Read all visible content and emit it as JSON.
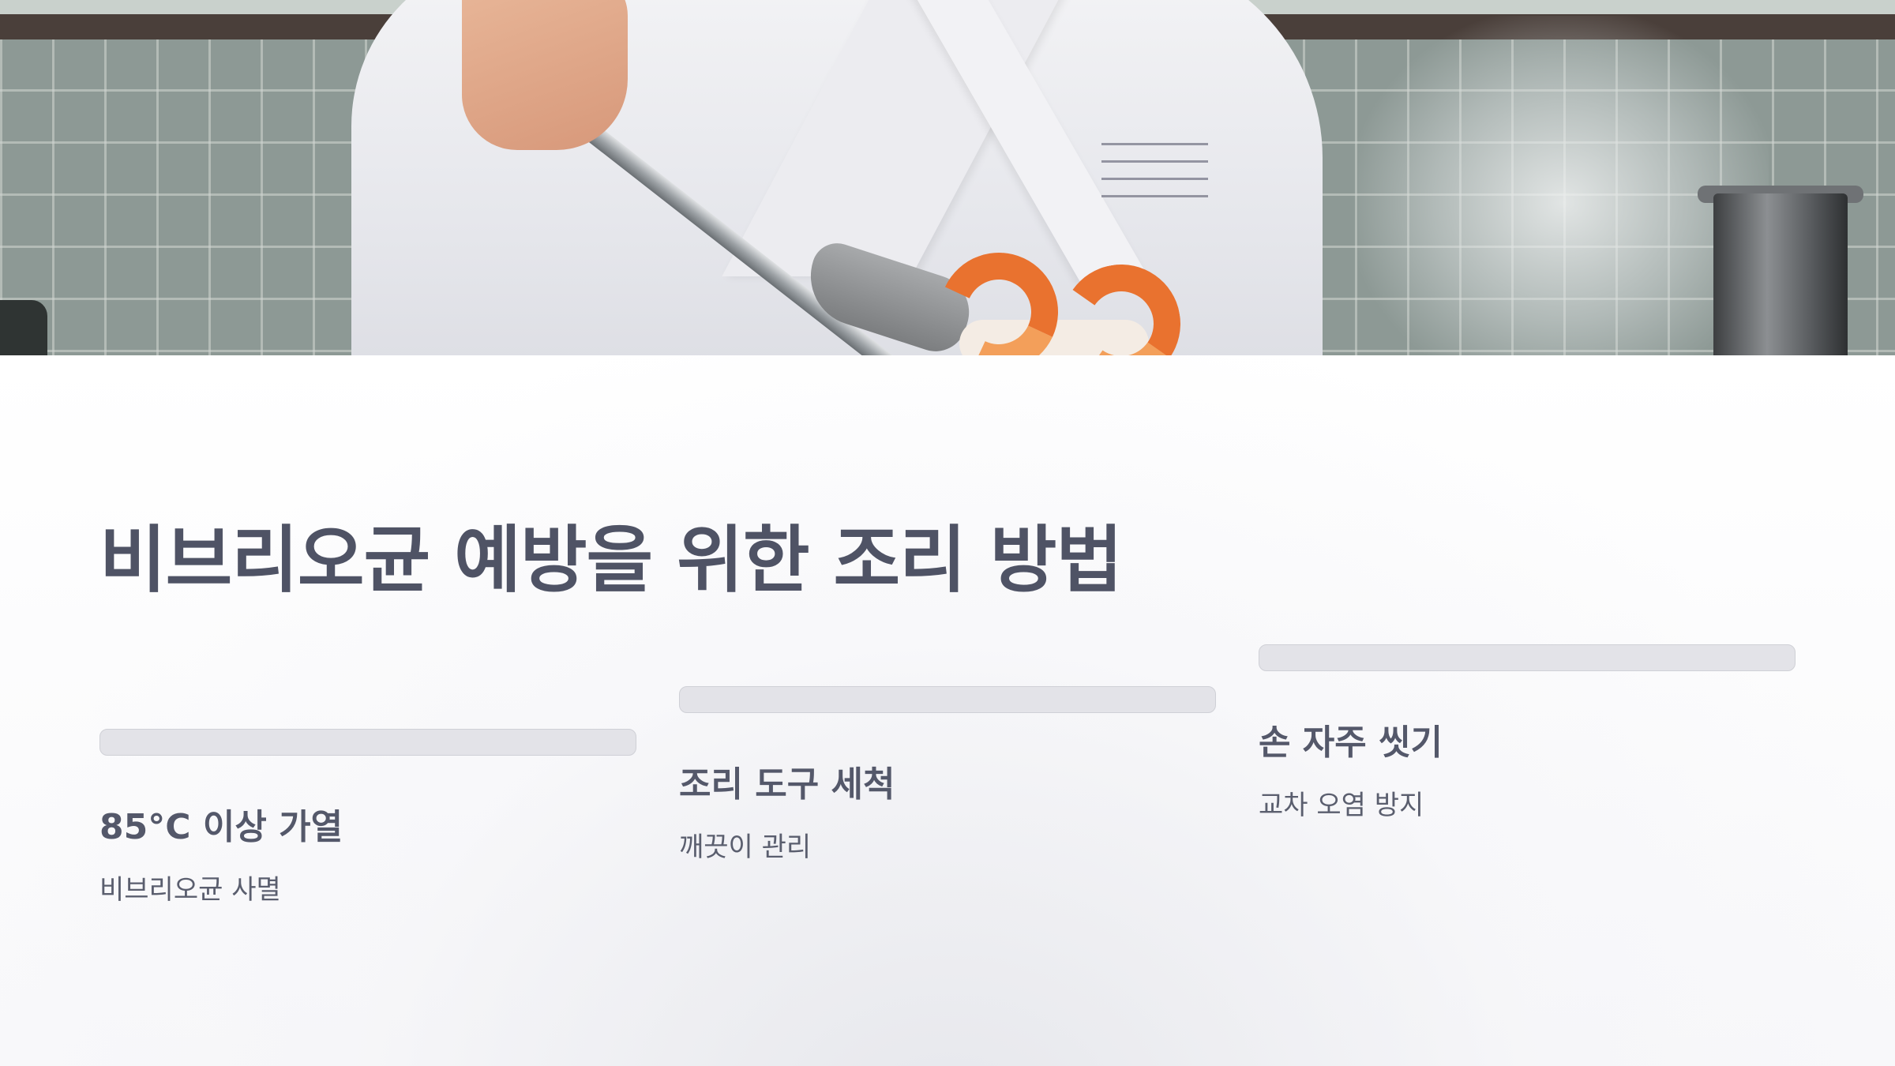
{
  "hero": {
    "image": "chef-holding-shrimp-with-tongs-photo"
  },
  "title": "비브리오균 예방을 위한 조리 방법",
  "cards": [
    {
      "heading": "85°C 이상 가열",
      "description": "비브리오균 사멸"
    },
    {
      "heading": "조리 도구 세척",
      "description": "깨끗이 관리"
    },
    {
      "heading": "손 자주 씻기",
      "description": "교차 오염 방지"
    }
  ],
  "colors": {
    "title": "#4f5365",
    "card_heading": "#54586a",
    "card_text": "#5a5e6e",
    "bar_fill": "#e3e3e8",
    "background": "#ffffff"
  }
}
